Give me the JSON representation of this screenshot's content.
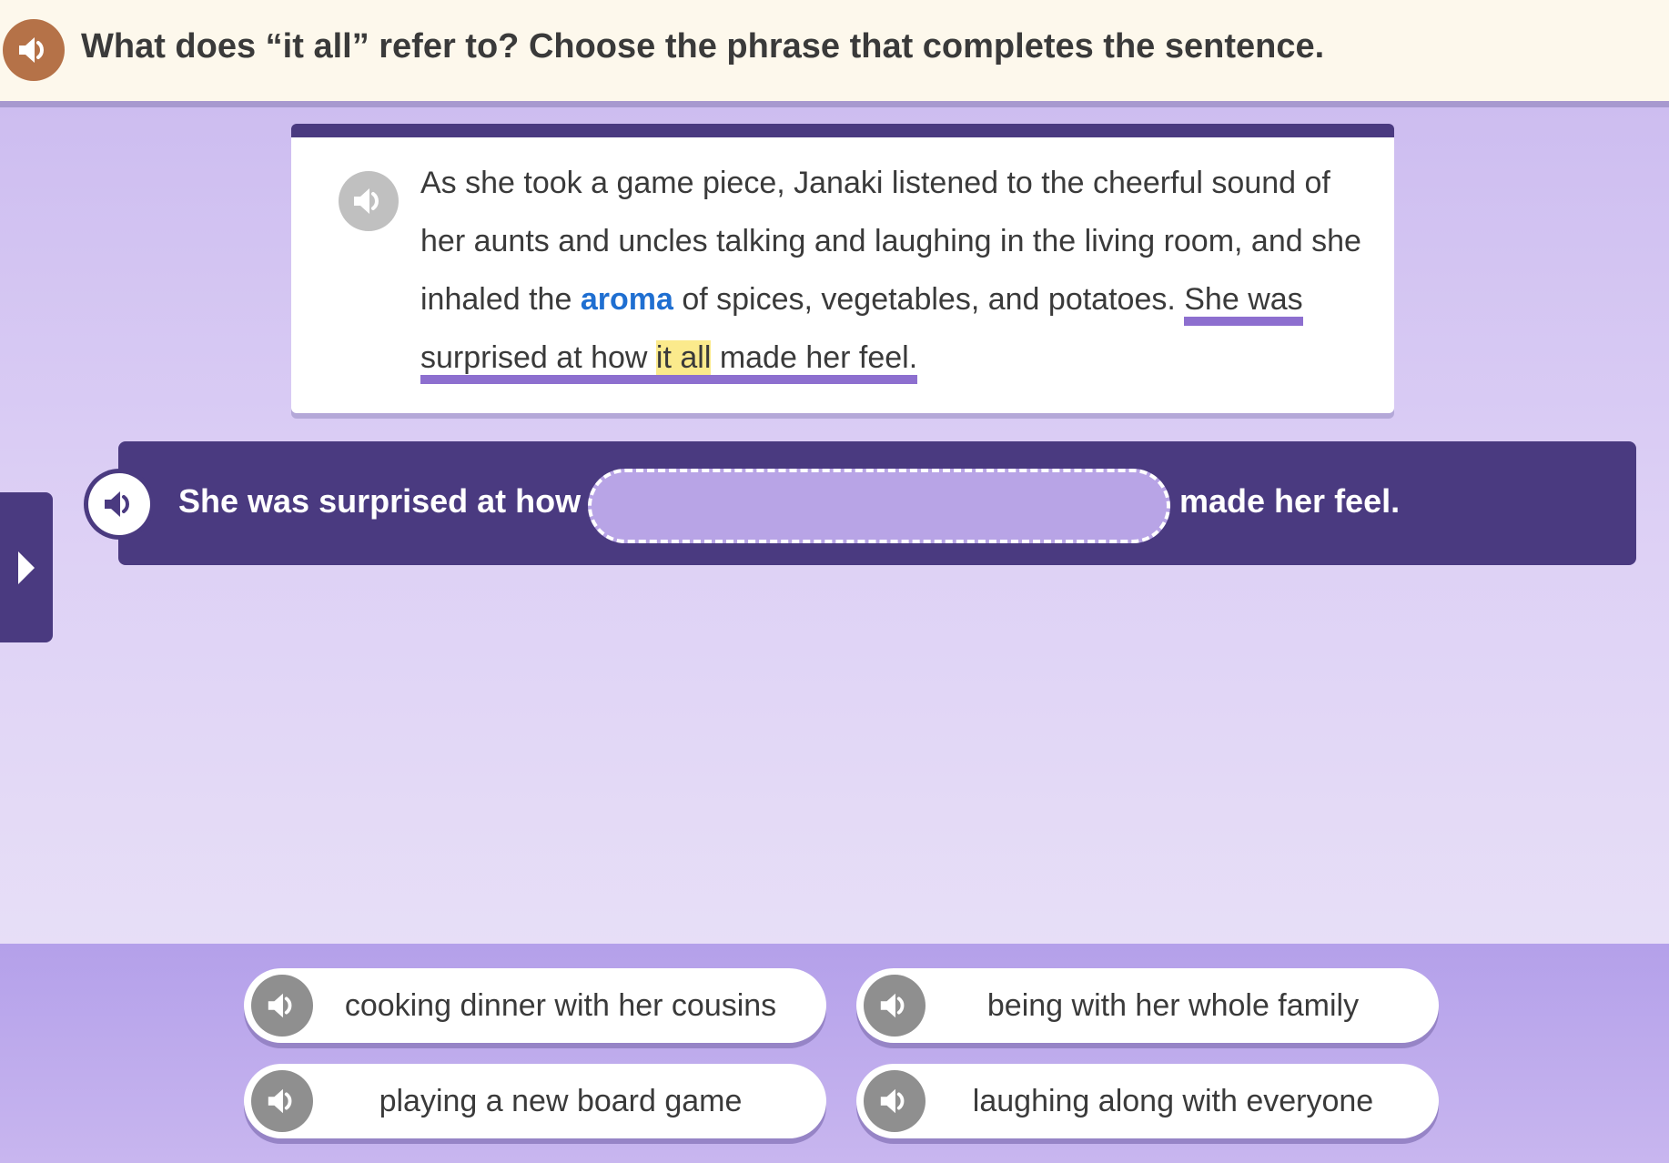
{
  "header": {
    "title": "What does “it all” refer to? Choose the phrase that completes the sentence."
  },
  "passage": {
    "before_vocab": "As she took a game piece, Janaki listened to the cheerful sound of her aunts and uncles talking and laughing in the living room, and she inhaled the ",
    "vocab_word": "aroma",
    "after_vocab": " of spices, vegetables, and potatoes. ",
    "focus_before": "She was surprised at how ",
    "focus_highlight": "it all",
    "focus_after": " made her feel."
  },
  "sentence_frame": {
    "before_blank": "She was surprised at how",
    "after_blank": "made her feel."
  },
  "choices": [
    {
      "label": "cooking dinner with her cousins"
    },
    {
      "label": "being with her whole family"
    },
    {
      "label": "playing a new board game"
    },
    {
      "label": "laughing along with everyone"
    }
  ],
  "icons": {
    "speaker": "speaker-icon",
    "side_tab": "play-triangle-icon"
  },
  "colors": {
    "header_bg": "#fdf8ec",
    "header_audio": "#b57248",
    "frame_bg": "#4a3a80",
    "blank_bg": "#b8a4e6",
    "vocab": "#1f6fd1",
    "highlight": "#fbea8c",
    "underline": "#8d6fcf"
  }
}
